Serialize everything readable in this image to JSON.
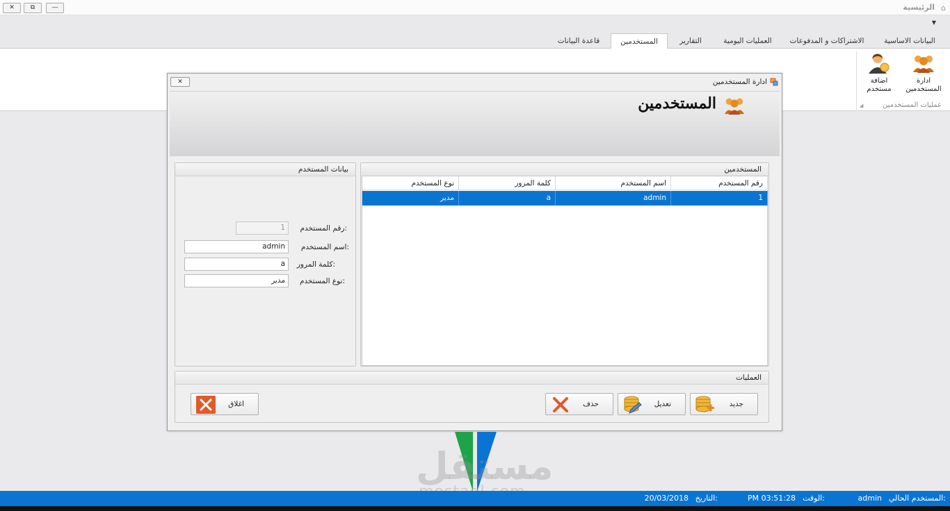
{
  "app": {
    "title": "الرئيسية"
  },
  "window_controls": {
    "close": "✕",
    "restore": "⧉",
    "minimize": "—"
  },
  "ribbon": {
    "tabs": [
      "البيانات الاساسية",
      "الاشتراكات و المدفوعات",
      "العمليات اليومية",
      "التقارير",
      "المستخدمين",
      "قاعدة البيانات"
    ],
    "active_tab": "المستخدمين",
    "buttons": [
      {
        "label_line1": "ادارة",
        "label_line2": "المستخدمين",
        "icon": "users-icon"
      },
      {
        "label_line1": "اضافة",
        "label_line2": "مستخدم",
        "icon": "add-user-icon"
      }
    ],
    "group_label": "عمليات المستخدمين"
  },
  "dialog": {
    "title": "ادارة المستخدمين",
    "close": "✕",
    "header_title": "المستخدمين",
    "users_panel": {
      "title": "المستخدمين",
      "columns": [
        "رقم المستخدم",
        "اسم المستخدم",
        "كلمة المرور",
        "نوع المستخدم"
      ],
      "rows": [
        {
          "id": "1",
          "username": "admin",
          "password": "a",
          "type": "مدير"
        }
      ]
    },
    "details_panel": {
      "title": "بيانات المستخدم",
      "fields": {
        "id": {
          "label": "رقم المستخدم:",
          "value": "1"
        },
        "username": {
          "label": "اسم المستخدم:",
          "value": "admin"
        },
        "password": {
          "label": "كلمة المرور:",
          "value": "a"
        },
        "type": {
          "label": "نوع المستخدم:",
          "value": "مدير"
        }
      }
    },
    "actions_panel": {
      "title": "العمليات",
      "new": "جديد",
      "edit": "تعديل",
      "delete": "حذف",
      "close": "اغلاق"
    }
  },
  "watermark": {
    "text": "مستقل",
    "url": "mostaql.com"
  },
  "status": {
    "user_label": "المستخدم الحالي:",
    "user_value": "admin",
    "time_label": "الوقت:",
    "time_value": "PM 03:51:28",
    "date_label": "التاريخ:",
    "date_value": "20/03/2018"
  },
  "colors": {
    "accent": "#0a74d2",
    "selection": "#0a74d2",
    "delete_red": "#e05a2a"
  }
}
